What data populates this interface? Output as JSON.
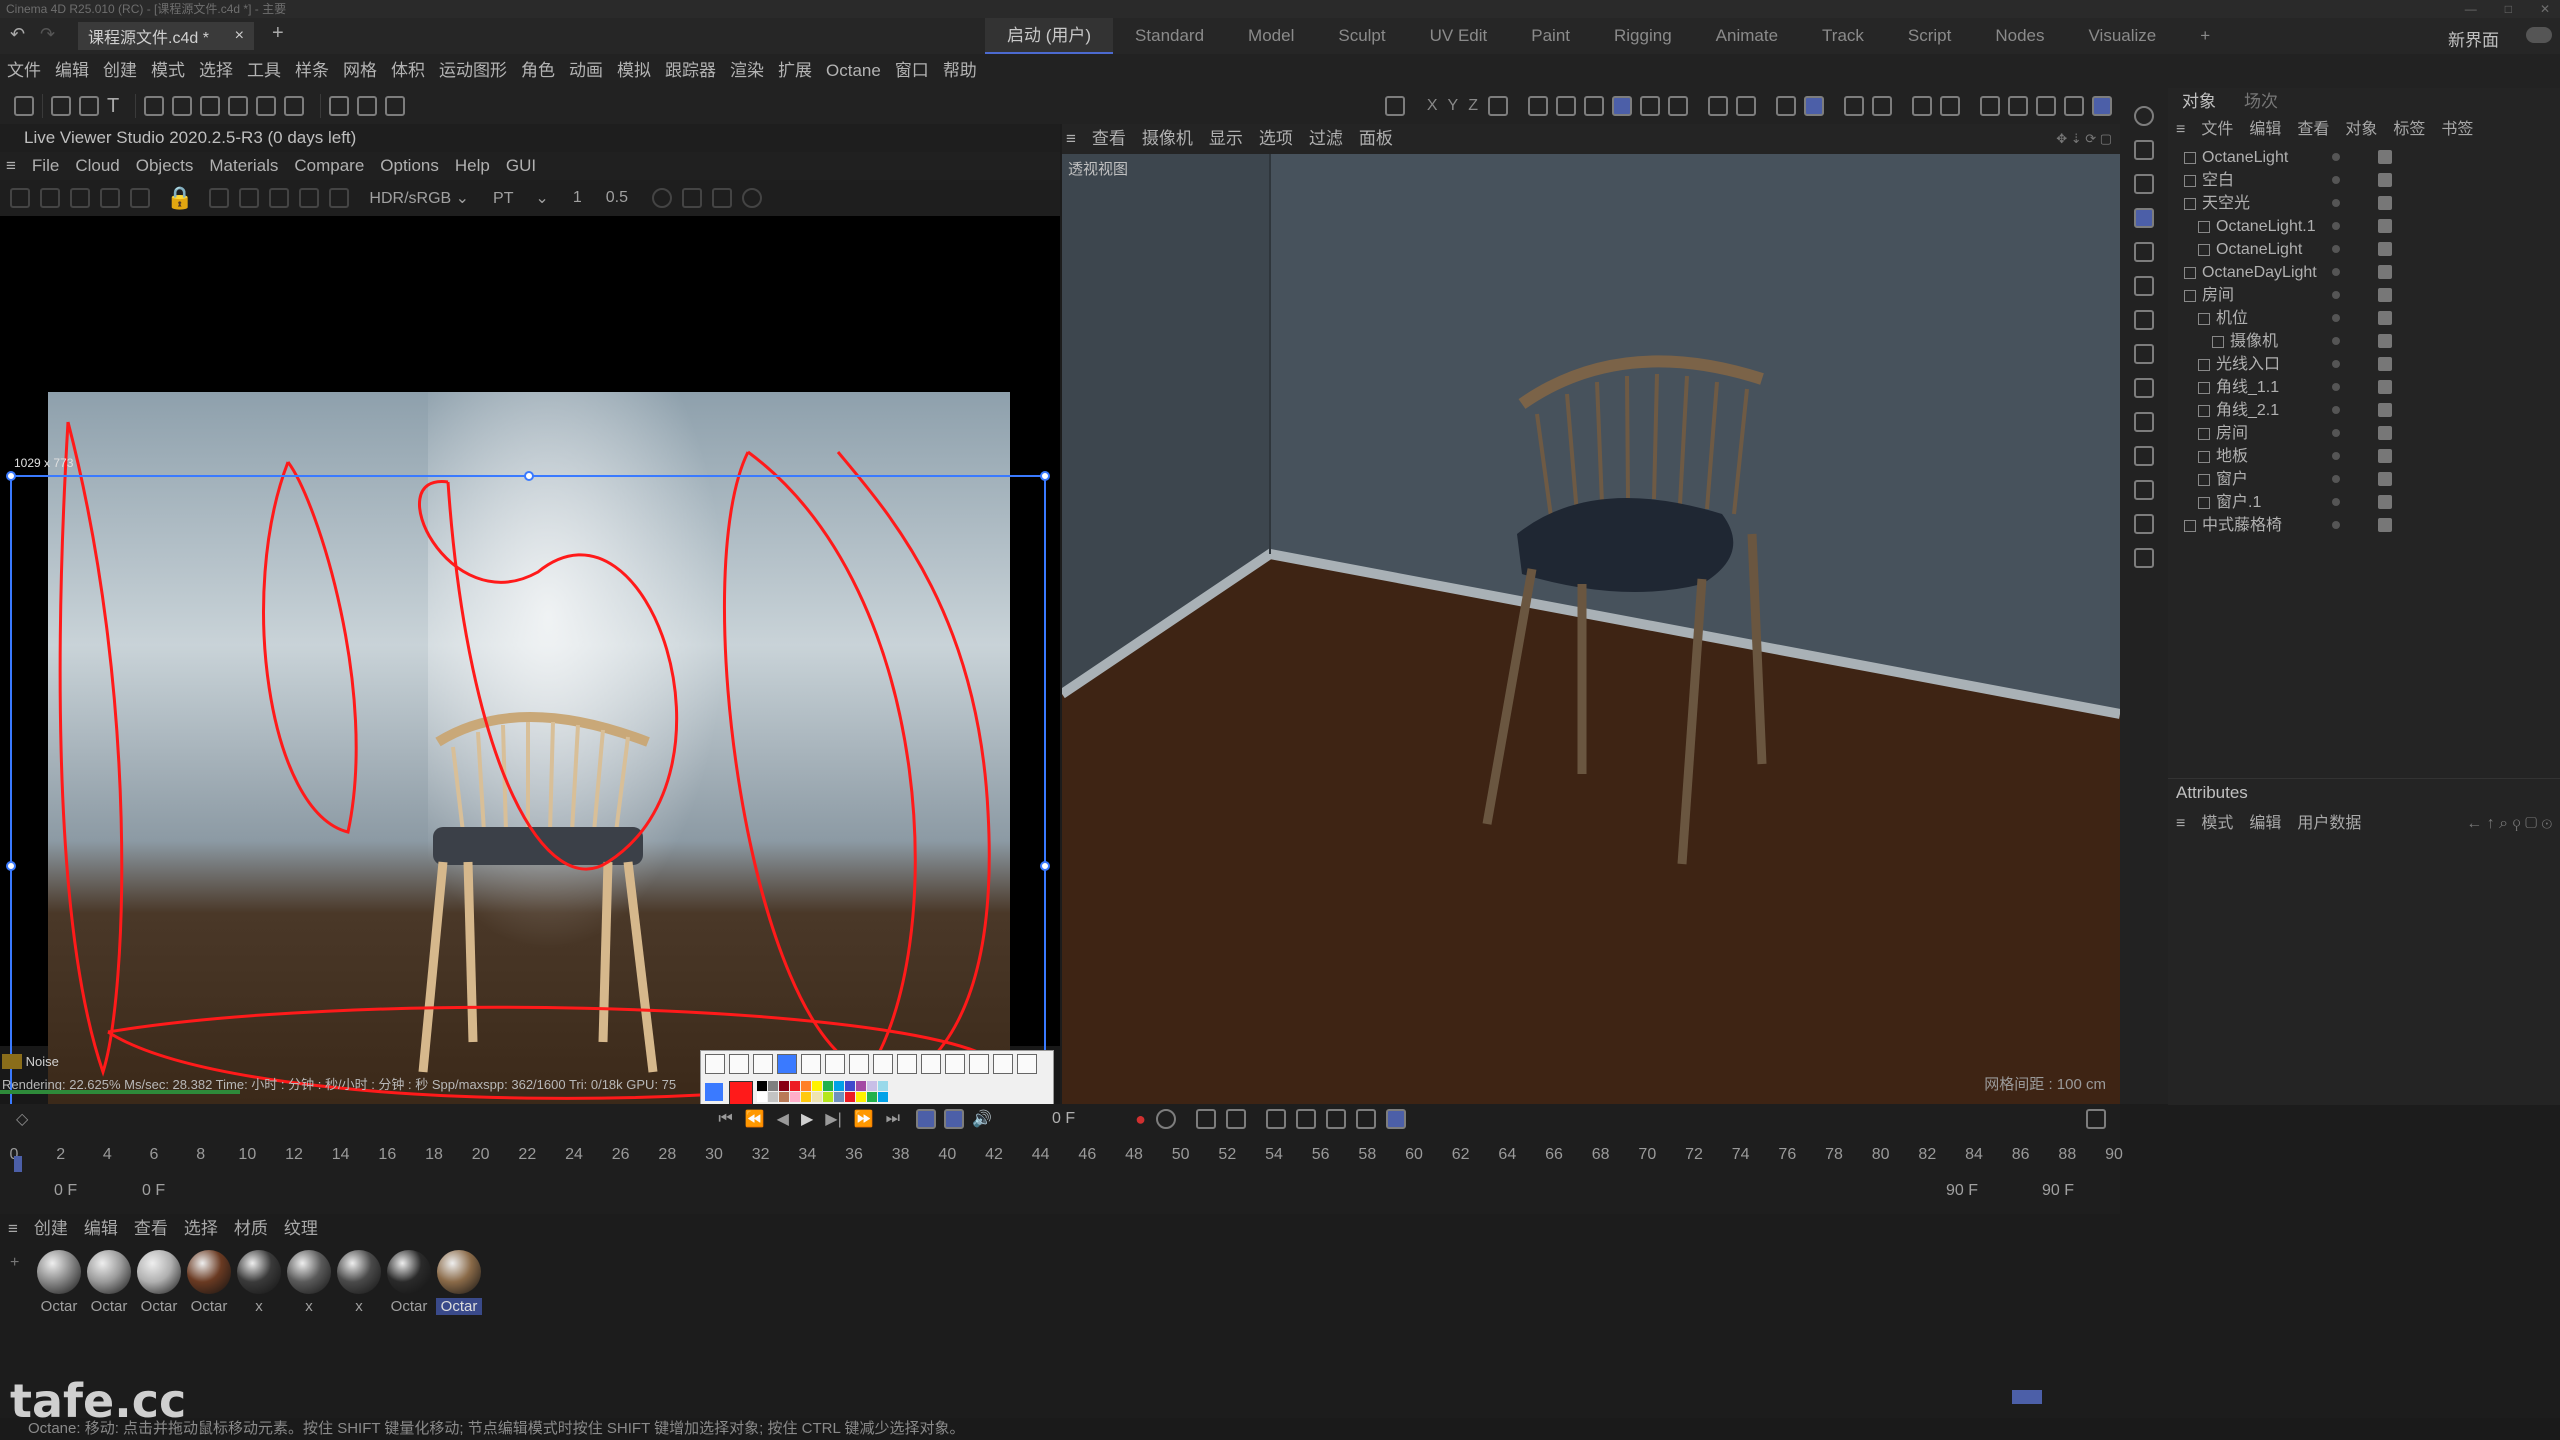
{
  "window": {
    "title": "Cinema 4D R25.010 (RC) - [课程源文件.c4d *] - 主要"
  },
  "document_tab": {
    "label": "课程源文件.c4d *",
    "close": "×",
    "add": "+"
  },
  "layouts": [
    "启动 (用户)",
    "Standard",
    "Model",
    "Sculpt",
    "UV Edit",
    "Paint",
    "Rigging",
    "Animate",
    "Track",
    "Script",
    "Nodes",
    "Visualize"
  ],
  "layout_extra": {
    "new_layout": "新界面"
  },
  "main_menu": [
    "文件",
    "编辑",
    "创建",
    "模式",
    "选择",
    "工具",
    "样条",
    "网格",
    "体积",
    "运动图形",
    "角色",
    "动画",
    "模拟",
    "跟踪器",
    "渲染",
    "扩展",
    "Octane",
    "窗口",
    "帮助"
  ],
  "live_viewer": {
    "title": "Live Viewer Studio 2020.2.5-R3 (0 days left)",
    "menu": [
      "File",
      "Cloud",
      "Objects",
      "Materials",
      "Compare",
      "Options",
      "Help",
      "GUI"
    ],
    "color_space": "HDR/sRGB",
    "kernel": "PT",
    "value_a": "1",
    "value_b": "0.5",
    "selection_size": "1029 x 773",
    "noise_label": "Noise",
    "status_line": "Rendering: 22.625%    Ms/sec: 28.382    Time: 小时 : 分钟 : 秒/小时 : 分钟 : 秒    Spp/maxspp: 362/1600    Tri: 0/18k    GPU: 75",
    "progress_percent": 22.625
  },
  "viewport": {
    "menu": [
      "查看",
      "摄像机",
      "显示",
      "选项",
      "过滤",
      "面板"
    ],
    "label": "透视视图",
    "grid_label": "网格间距 : 100 cm"
  },
  "object_manager": {
    "tabs": [
      "对象",
      "场次"
    ],
    "menu": [
      "文件",
      "编辑",
      "查看",
      "对象",
      "标签",
      "书签"
    ],
    "items": [
      {
        "name": "OctaneLight",
        "indent": 0
      },
      {
        "name": "空白",
        "indent": 0
      },
      {
        "name": "天空光",
        "indent": 0
      },
      {
        "name": "OctaneLight.1",
        "indent": 1
      },
      {
        "name": "OctaneLight",
        "indent": 1
      },
      {
        "name": "OctaneDayLight",
        "indent": 0
      },
      {
        "name": "房间",
        "indent": 0
      },
      {
        "name": "机位",
        "indent": 1
      },
      {
        "name": "摄像机",
        "indent": 2
      },
      {
        "name": "光线入口",
        "indent": 1
      },
      {
        "name": "角线_1.1",
        "indent": 1
      },
      {
        "name": "角线_2.1",
        "indent": 1
      },
      {
        "name": "房间",
        "indent": 1
      },
      {
        "name": "地板",
        "indent": 1
      },
      {
        "name": "窗户",
        "indent": 1
      },
      {
        "name": "窗户.1",
        "indent": 1
      },
      {
        "name": "中式藤格椅",
        "indent": 0
      }
    ]
  },
  "attributes": {
    "title": "Attributes",
    "menu": [
      "模式",
      "编辑",
      "用户数据"
    ]
  },
  "timeline": {
    "current_frame": "0 F",
    "ticks": [
      "0",
      "2",
      "4",
      "6",
      "8",
      "10",
      "12",
      "14",
      "16",
      "18",
      "20",
      "22",
      "24",
      "26",
      "28",
      "30",
      "32",
      "34",
      "36",
      "38",
      "40",
      "42",
      "44",
      "46",
      "48",
      "50",
      "52",
      "54",
      "56",
      "58",
      "60",
      "62",
      "64",
      "66",
      "68",
      "70",
      "72",
      "74",
      "76",
      "78",
      "80",
      "82",
      "84",
      "86",
      "88",
      "90"
    ],
    "start_a": "0 F",
    "start_b": "0 F",
    "end_a": "90 F",
    "end_b": "90 F"
  },
  "material_manager": {
    "menu": [
      "创建",
      "编辑",
      "查看",
      "选择",
      "材质",
      "纹理"
    ],
    "materials": [
      {
        "label": "Octar",
        "color": "#8a8a8a"
      },
      {
        "label": "Octar",
        "color": "#9a9a9a"
      },
      {
        "label": "Octar",
        "color": "#b0b0b0"
      },
      {
        "label": "Octar",
        "color": "#6a3a22"
      },
      {
        "label": "x",
        "color": "#3a3a3a"
      },
      {
        "label": "x",
        "color": "#5a5a5a"
      },
      {
        "label": "x",
        "color": "#4a4a4a"
      },
      {
        "label": "Octar",
        "color": "#2a2a2a"
      },
      {
        "label": "Octar",
        "color": "#8a6a48"
      }
    ]
  },
  "watermark": "tafe.cc",
  "status_bar": "Octane:  移动: 点击并拖动鼠标移动元素。按住 SHIFT 键量化移动; 节点编辑模式时按住 SHIFT 键增加选择对象; 按住 CTRL 键减少选择对象。",
  "colors": {
    "accent": "#3a7aff",
    "annotation": "#ff1a1a",
    "progress": "#2e8a3a"
  }
}
